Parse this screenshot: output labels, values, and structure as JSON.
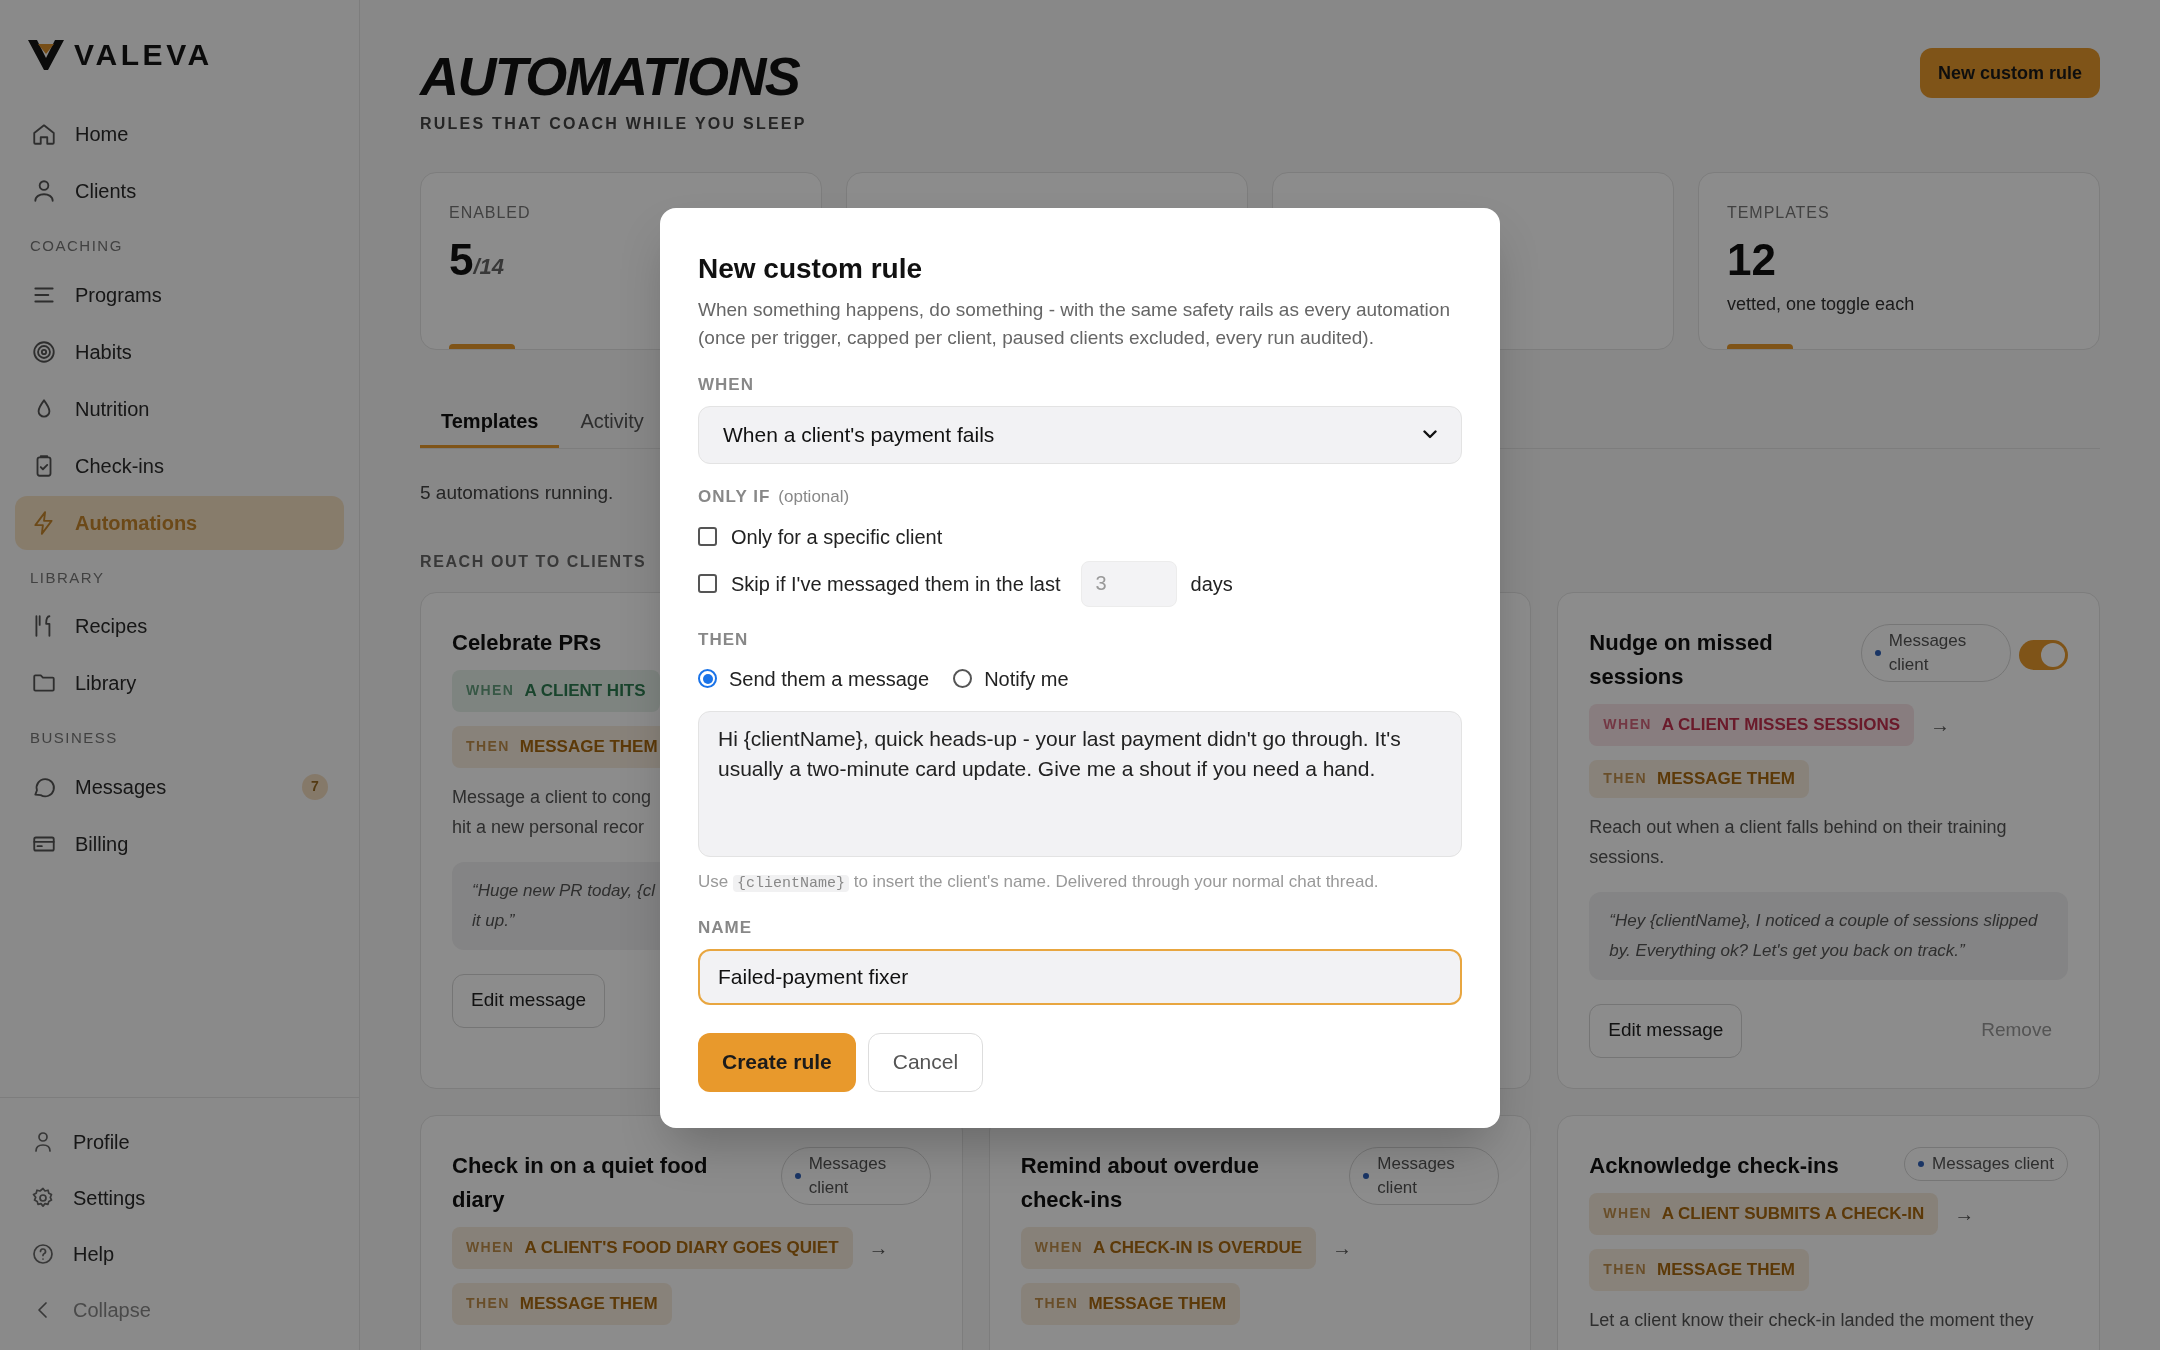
{
  "sidebar": {
    "brand": "VALEVA",
    "groups": [
      {
        "items": [
          {
            "label": "Home",
            "selected": false
          },
          {
            "label": "Clients",
            "selected": false
          }
        ]
      },
      {
        "heading": "COACHING",
        "items": [
          {
            "label": "Programs",
            "selected": false
          },
          {
            "label": "Habits",
            "selected": false
          },
          {
            "label": "Nutrition",
            "selected": false
          },
          {
            "label": "Check-ins",
            "selected": false
          },
          {
            "label": "Automations",
            "selected": true
          }
        ]
      },
      {
        "heading": "LIBRARY",
        "items": [
          {
            "label": "Recipes",
            "selected": false
          },
          {
            "label": "Library",
            "selected": false
          }
        ]
      },
      {
        "heading": "BUSINESS",
        "items": [
          {
            "label": "Messages",
            "selected": false,
            "badge": "7"
          },
          {
            "label": "Billing",
            "selected": false
          }
        ]
      }
    ],
    "footer": [
      {
        "label": "Profile",
        "muted": false
      },
      {
        "label": "Settings",
        "muted": false
      },
      {
        "label": "Help",
        "muted": false
      },
      {
        "label": "Collapse",
        "muted": true
      }
    ]
  },
  "header": {
    "title": "AUTOMATIONS",
    "subtitle": "RULES THAT COACH WHILE YOU SLEEP",
    "action": "New custom rule"
  },
  "stats": [
    {
      "kind": "stat",
      "label": "ENABLED",
      "value": "5",
      "suffix": "/14"
    },
    {
      "kind": "covered"
    },
    {
      "kind": "covered"
    },
    {
      "kind": "stat",
      "label": "TEMPLATES",
      "value": "12",
      "note": "vetted, one toggle each"
    }
  ],
  "tabs": [
    {
      "label": "Templates",
      "selected": true
    },
    {
      "label": "Activity",
      "selected": false
    }
  ],
  "summary": "5 automations running.",
  "section_title": "REACH OUT TO CLIENTS",
  "cards": [
    {
      "kind": "rule",
      "title": "Celebrate PRs",
      "when": {
        "label": "WHEN",
        "text": "A CLIENT HITS",
        "kind": "positive"
      },
      "then": {
        "label": "THEN",
        "text": "MESSAGE THEM"
      },
      "description_lines": [
        "Message a client to cong",
        "hit a new personal recor"
      ],
      "quote_lines": [
        "“Huge new PR today, {cl",
        "it up.”"
      ],
      "edit": "Edit message"
    },
    {
      "kind": "covered"
    },
    {
      "kind": "rule",
      "title": "Nudge on missed sessions",
      "chip": "Messages client",
      "enabled": true,
      "when": {
        "label": "WHEN",
        "text": "A CLIENT MISSES SESSIONS",
        "kind": "alert",
        "arrow": "→"
      },
      "then": {
        "label": "THEN",
        "text": "MESSAGE THEM"
      },
      "description_lines": [
        "Reach out when a client falls behind on their training sessions."
      ],
      "quote_lines": [
        "“Hey {clientName}, I noticed a couple of sessions slipped by. Everything ok? Let's get you back on track.”"
      ],
      "edit": "Edit message",
      "remove": "Remove"
    },
    {
      "kind": "rule",
      "title": "Check in on a quiet food diary",
      "chip": "Messages client",
      "when": {
        "label": "WHEN",
        "text": "A CLIENT'S FOOD DIARY GOES QUIET",
        "kind": "neutral",
        "arrow": "→"
      },
      "then": {
        "label": "THEN",
        "text": "MESSAGE THEM"
      }
    },
    {
      "kind": "rule",
      "title": "Remind about overdue check-ins",
      "chip": "Messages client",
      "when": {
        "label": "WHEN",
        "text": "A CHECK-IN IS OVERDUE",
        "kind": "neutral",
        "arrow": "→"
      },
      "then": {
        "label": "THEN",
        "text": "MESSAGE THEM"
      }
    },
    {
      "kind": "rule",
      "title": "Acknowledge check-ins",
      "chip": "Messages client",
      "when": {
        "label": "WHEN",
        "text": "A CLIENT SUBMITS A CHECK-IN",
        "kind": "neutral",
        "arrow": "→"
      },
      "then": {
        "label": "THEN",
        "text": "MESSAGE THEM"
      },
      "description_lines": [
        "Let a client know their check-in landed the moment they"
      ]
    }
  ],
  "modal": {
    "title": "New custom rule",
    "description": "When something happens, do something - with the same safety rails as every automation (once per trigger, capped per client, paused clients excluded, every run audited).",
    "when": {
      "label": "WHEN",
      "value": "When a client's payment fails"
    },
    "only_if": {
      "label": "ONLY IF",
      "hint": "(optional)",
      "options": [
        {
          "kind": "plain",
          "label": "Only for a specific client",
          "checked": false
        },
        {
          "kind": "days",
          "label": "Skip if I've messaged them in the last",
          "checked": false,
          "placeholder": "3",
          "unit": "days"
        }
      ]
    },
    "then": {
      "label": "THEN",
      "options": [
        {
          "label": "Send them a message",
          "selected": true
        },
        {
          "label": "Notify me",
          "selected": false
        }
      ],
      "message": "Hi {clientName}, quick heads-up - your last payment didn't go through. It's usually a two-minute card update. Give me a shout if you need a hand.",
      "hint_before": "Use",
      "hint_code": "{clientName}",
      "hint_after": "to insert the client's name. Delivered through your normal chat thread."
    },
    "name": {
      "label": "NAME",
      "value": "Failed-payment fixer"
    },
    "buttons": [
      {
        "label": "Create rule",
        "kind": "primary"
      },
      {
        "label": "Cancel",
        "kind": "secondary"
      }
    ]
  }
}
